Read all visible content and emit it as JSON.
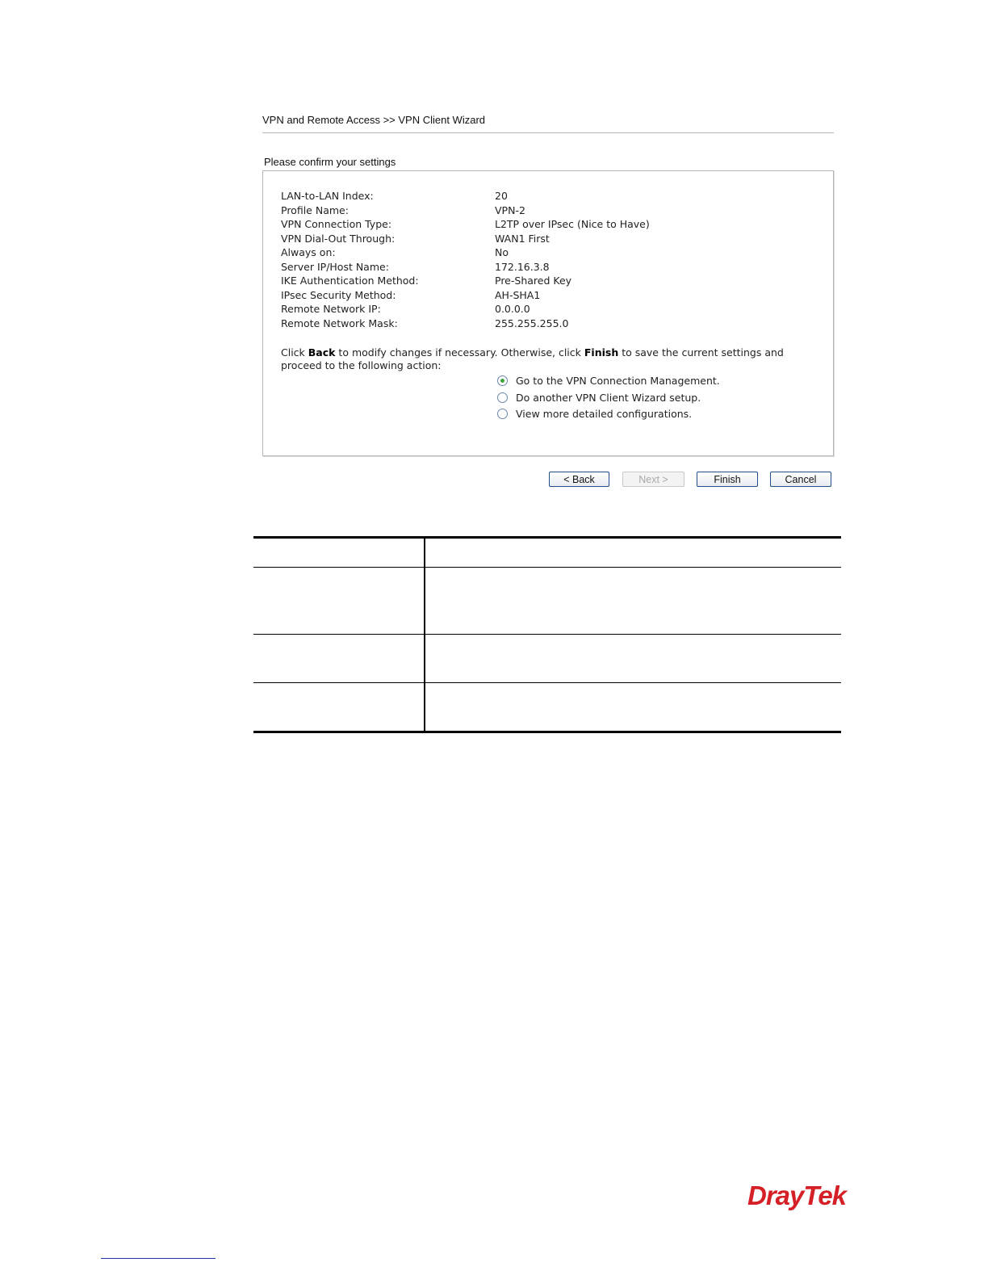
{
  "breadcrumb": "VPN and Remote Access >> VPN Client Wizard",
  "section_title": "Please confirm your settings",
  "settings": [
    {
      "label": "LAN-to-LAN Index:",
      "value": "20"
    },
    {
      "label": "Profile Name:",
      "value": "VPN-2"
    },
    {
      "label": "VPN Connection Type:",
      "value": "L2TP over IPsec (Nice to Have)"
    },
    {
      "label": "VPN Dial-Out Through:",
      "value": "WAN1 First"
    },
    {
      "label": "Always on:",
      "value": "No"
    },
    {
      "label": "Server IP/Host Name:",
      "value": "172.16.3.8"
    },
    {
      "label": "IKE Authentication Method:",
      "value": "Pre-Shared Key"
    },
    {
      "label": "IPsec Security Method:",
      "value": "AH-SHA1"
    },
    {
      "label": "Remote Network IP:",
      "value": "0.0.0.0"
    },
    {
      "label": "Remote Network Mask:",
      "value": "255.255.255.0"
    }
  ],
  "note": {
    "part1": "Click ",
    "back": "Back",
    "part2": " to modify changes if necessary. Otherwise, click ",
    "finish": "Finish",
    "part3": " to save the current settings and proceed to the following action:"
  },
  "options": [
    {
      "label": "Go to the VPN Connection Management.",
      "selected": true
    },
    {
      "label": "Do another VPN Client Wizard setup.",
      "selected": false
    },
    {
      "label": "View more detailed configurations.",
      "selected": false
    }
  ],
  "buttons": {
    "back": "< Back",
    "next": "Next >",
    "finish": "Finish",
    "cancel": "Cancel"
  },
  "logo_text": "DrayTek",
  "colors": {
    "logo": "#d62027",
    "radio_selected": "#3aa53a",
    "button_border": "#1f4f86"
  }
}
